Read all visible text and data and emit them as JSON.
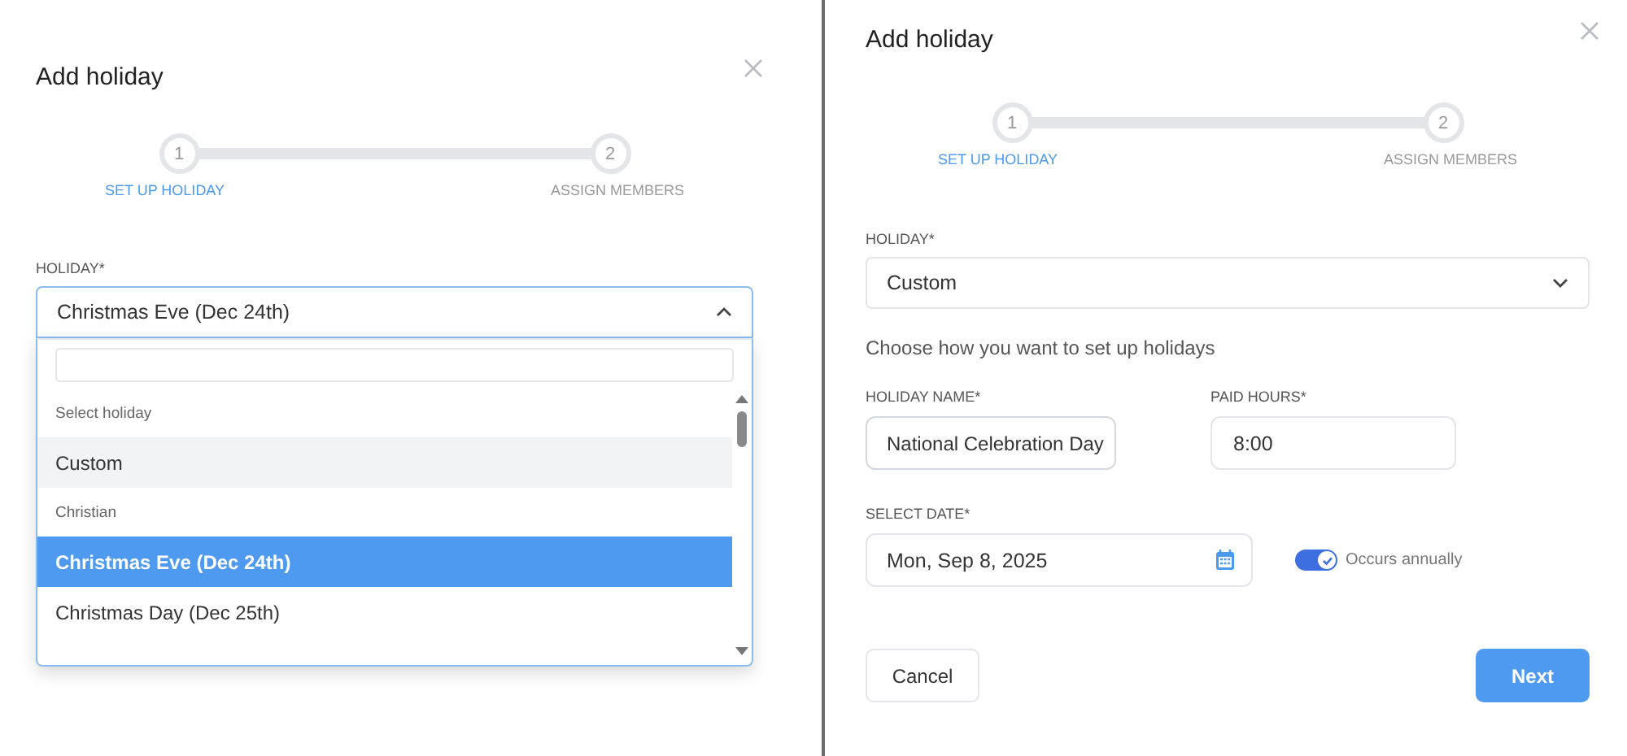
{
  "left_dialog": {
    "title": "Add holiday",
    "steps": [
      {
        "number": "1",
        "label": "SET UP HOLIDAY",
        "active": true
      },
      {
        "number": "2",
        "label": "ASSIGN MEMBERS",
        "active": false
      }
    ],
    "holiday_label": "HOLIDAY*",
    "holiday_value": "Christmas Eve (Dec 24th)",
    "expanded": true,
    "options": [
      {
        "kind": "header",
        "label": "Select holiday"
      },
      {
        "kind": "option",
        "label": "Custom",
        "hovered": true,
        "selected": false
      },
      {
        "kind": "header",
        "label": "Christian"
      },
      {
        "kind": "option",
        "label": "Christmas Eve (Dec 24th)",
        "hovered": false,
        "selected": true
      },
      {
        "kind": "option",
        "label": "Christmas Day (Dec 25th)",
        "hovered": false,
        "selected": false
      }
    ]
  },
  "right_dialog": {
    "title": "Add holiday",
    "steps": [
      {
        "number": "1",
        "label": "SET UP HOLIDAY",
        "active": true
      },
      {
        "number": "2",
        "label": "ASSIGN MEMBERS",
        "active": false
      }
    ],
    "holiday_label": "HOLIDAY*",
    "holiday_value": "Custom",
    "expanded": false,
    "hint": "Choose how you want to set up holidays",
    "name_label": "HOLIDAY NAME*",
    "name_value": "National Celebration Day",
    "hours_label": "PAID HOURS*",
    "hours_value": "8:00",
    "date_label": "SELECT DATE*",
    "date_value": "Mon, Sep 8, 2025",
    "annual": {
      "label": "Occurs annually",
      "on": true
    },
    "buttons": {
      "cancel": "Cancel",
      "next": "Next"
    }
  }
}
